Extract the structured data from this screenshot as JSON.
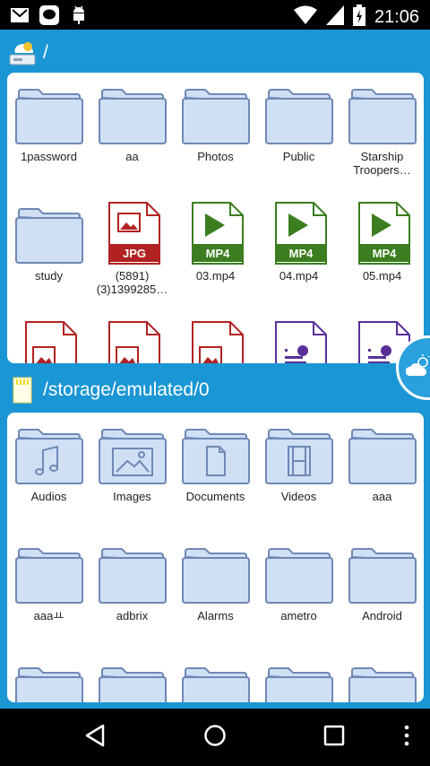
{
  "status_bar": {
    "notifications": [
      "gmail-icon",
      "line-icon",
      "android-debug-icon"
    ],
    "system": [
      "wifi-icon",
      "signal-icon",
      "battery-icon"
    ],
    "time": "21:06"
  },
  "root_section": {
    "path": "/",
    "icon": "drive-icon",
    "items": [
      {
        "label": "1password",
        "type": "folder"
      },
      {
        "label": "aa",
        "type": "folder"
      },
      {
        "label": "Photos",
        "type": "folder"
      },
      {
        "label": "Public",
        "type": "folder"
      },
      {
        "label": "Starship\nTroopers…",
        "type": "folder"
      },
      {
        "label": "study",
        "type": "folder"
      },
      {
        "label": "(5891)\n(3)1399285…",
        "type": "jpg",
        "badge": "JPG"
      },
      {
        "label": "03.mp4",
        "type": "mp4",
        "badge": "MP4"
      },
      {
        "label": "04.mp4",
        "type": "mp4",
        "badge": "MP4"
      },
      {
        "label": "05.mp4",
        "type": "mp4",
        "badge": "MP4"
      },
      {
        "label": "",
        "type": "image"
      },
      {
        "label": "",
        "type": "image"
      },
      {
        "label": "",
        "type": "image"
      },
      {
        "label": "",
        "type": "document"
      },
      {
        "label": "",
        "type": "document"
      }
    ]
  },
  "storage_section": {
    "path": "/storage/emulated/0",
    "icon": "sd-card-icon",
    "items": [
      {
        "label": "Audios",
        "type": "folder-music"
      },
      {
        "label": "Images",
        "type": "folder-image"
      },
      {
        "label": "Documents",
        "type": "folder-doc"
      },
      {
        "label": "Videos",
        "type": "folder-video"
      },
      {
        "label": "aaa",
        "type": "folder"
      },
      {
        "label": "aaaㅛ",
        "type": "folder"
      },
      {
        "label": "adbrix",
        "type": "folder"
      },
      {
        "label": "Alarms",
        "type": "folder"
      },
      {
        "label": "ametro",
        "type": "folder"
      },
      {
        "label": "Android",
        "type": "folder"
      },
      {
        "label": "",
        "type": "folder"
      },
      {
        "label": "",
        "type": "folder"
      },
      {
        "label": "",
        "type": "folder"
      },
      {
        "label": "",
        "type": "folder"
      },
      {
        "label": "",
        "type": "folder"
      }
    ]
  },
  "floating_button": {
    "icon": "weather-cloud-icon"
  },
  "nav_bar": {
    "buttons": [
      "back-icon",
      "home-icon",
      "recents-icon",
      "overflow-menu-icon"
    ]
  },
  "colors": {
    "app_bg": "#1a96d4",
    "folder_fill": "#cfe0f5",
    "folder_stroke": "#6f88b6",
    "jpg_red": "#b22222",
    "mp4_green": "#3b7d1f",
    "doc_purple": "#5a2f99"
  }
}
